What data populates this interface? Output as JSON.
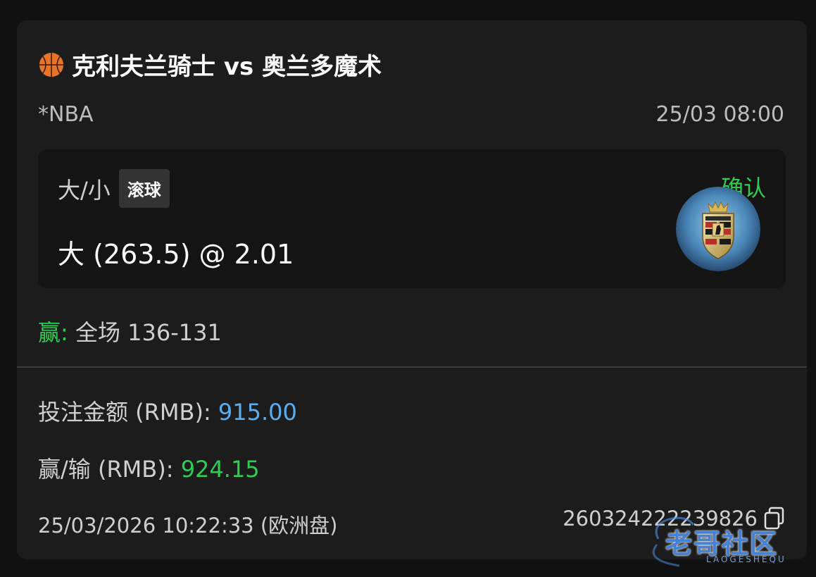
{
  "match": {
    "title": "克利夫兰骑士 vs 奥兰多魔术",
    "icon": "basketball-icon"
  },
  "league": "*NBA",
  "match_time": "25/03 08:00",
  "bet": {
    "market": "大/小",
    "live_tag": "滚球",
    "selection": "大 (263.5) @ 2.01",
    "status": "确认",
    "status_color": "#2ecc52"
  },
  "result": {
    "label": "赢:",
    "score": " 全场 136-131"
  },
  "stake": {
    "label": "投注金额 (RMB): ",
    "value": "915.00",
    "value_color": "#5aaef0"
  },
  "winloss": {
    "label": "赢/输 (RMB): ",
    "value": "924.15",
    "value_color": "#2ecc52"
  },
  "placed_time": "25/03/2026 10:22:33 (欧洲盘)",
  "bet_id": "260324222239826",
  "watermark": {
    "main": "老哥社区",
    "sub": "LAOGESHEQU"
  }
}
